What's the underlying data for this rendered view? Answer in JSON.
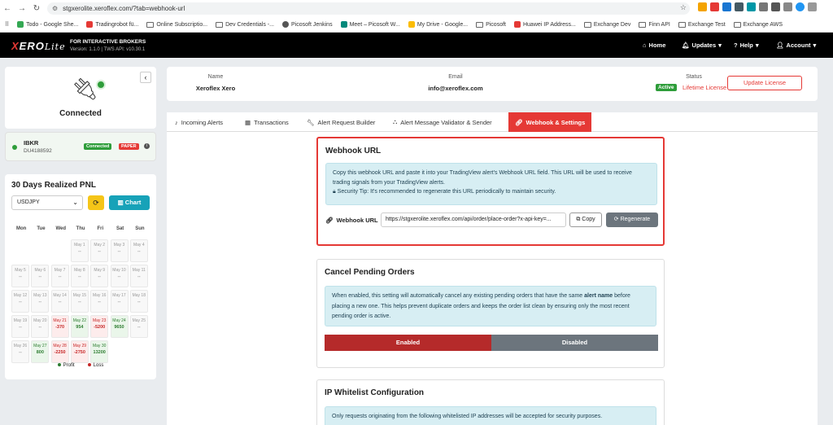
{
  "browser": {
    "url": "stgxerolite.xeroflex.com/?tab=webhook-url",
    "bookmarks": [
      "Todo - Google She...",
      "Tradingrobot fü...",
      "Online Subscriptio...",
      "Dev Credentials -...",
      "Picosoft Jenkins",
      "Meet – Picosoft W...",
      "My Drive - Google...",
      "Picosoft",
      "Huawei IP Address...",
      "Exchange Dev",
      "Finn API",
      "Exchange Test",
      "Exchange AWS"
    ]
  },
  "topnav": {
    "logo_x": "X",
    "logo_rest": "ERO",
    "logo_lite": "Lite",
    "brand_title": "FOR INTERACTIVE BROKERS",
    "brand_version": "Version: 1.1.0 | TWS API: v10.30.1",
    "home": "Home",
    "updates": "Updates",
    "help": "Help",
    "account": "Account"
  },
  "sidebar": {
    "status": "Connected",
    "account_name": "IBKR",
    "account_id": "DU4188592",
    "badge_connected": "Connected",
    "badge_paper": "PAPER",
    "pnl_title": "30 Days Realized PNL",
    "symbol": "USDJPY",
    "chart_label": "Chart",
    "day_names": [
      "Mon",
      "Tue",
      "Wed",
      "Thu",
      "Fri",
      "Sat",
      "Sun"
    ],
    "legend_profit": "Profit",
    "legend_loss": "Loss",
    "colors": {
      "profit": "#2e7d32",
      "loss": "#c62828"
    }
  },
  "calendar": [
    {
      "d": "May 1",
      "v": "--",
      "t": "n",
      "r": 0,
      "c": 3
    },
    {
      "d": "May 2",
      "v": "--",
      "t": "n",
      "r": 0,
      "c": 4
    },
    {
      "d": "May 3",
      "v": "--",
      "t": "n",
      "r": 0,
      "c": 5
    },
    {
      "d": "May 4",
      "v": "--",
      "t": "n",
      "r": 0,
      "c": 6
    },
    {
      "d": "May 5",
      "v": "--",
      "t": "n",
      "r": 1,
      "c": 0
    },
    {
      "d": "May 6",
      "v": "--",
      "t": "n",
      "r": 1,
      "c": 1
    },
    {
      "d": "May 7",
      "v": "--",
      "t": "n",
      "r": 1,
      "c": 2
    },
    {
      "d": "May 8",
      "v": "--",
      "t": "n",
      "r": 1,
      "c": 3
    },
    {
      "d": "May 9",
      "v": "--",
      "t": "n",
      "r": 1,
      "c": 4
    },
    {
      "d": "May 10",
      "v": "--",
      "t": "n",
      "r": 1,
      "c": 5
    },
    {
      "d": "May 11",
      "v": "--",
      "t": "n",
      "r": 1,
      "c": 6
    },
    {
      "d": "May 12",
      "v": "--",
      "t": "n",
      "r": 2,
      "c": 0
    },
    {
      "d": "May 13",
      "v": "--",
      "t": "n",
      "r": 2,
      "c": 1
    },
    {
      "d": "May 14",
      "v": "--",
      "t": "n",
      "r": 2,
      "c": 2
    },
    {
      "d": "May 15",
      "v": "--",
      "t": "n",
      "r": 2,
      "c": 3
    },
    {
      "d": "May 16",
      "v": "--",
      "t": "n",
      "r": 2,
      "c": 4
    },
    {
      "d": "May 17",
      "v": "--",
      "t": "n",
      "r": 2,
      "c": 5
    },
    {
      "d": "May 18",
      "v": "--",
      "t": "n",
      "r": 2,
      "c": 6
    },
    {
      "d": "May 19",
      "v": "--",
      "t": "n",
      "r": 3,
      "c": 0
    },
    {
      "d": "May 20",
      "v": "--",
      "t": "n",
      "r": 3,
      "c": 1
    },
    {
      "d": "May 21",
      "v": "-370",
      "t": "loss",
      "r": 3,
      "c": 2
    },
    {
      "d": "May 22",
      "v": "954",
      "t": "profit",
      "r": 3,
      "c": 3
    },
    {
      "d": "May 23",
      "v": "-5200",
      "t": "loss",
      "r": 3,
      "c": 4
    },
    {
      "d": "May 24",
      "v": "9650",
      "t": "profit",
      "r": 3,
      "c": 5
    },
    {
      "d": "May 25",
      "v": "--",
      "t": "n",
      "r": 3,
      "c": 6
    },
    {
      "d": "May 26",
      "v": "--",
      "t": "n",
      "r": 4,
      "c": 0
    },
    {
      "d": "May 27",
      "v": "800",
      "t": "profit",
      "r": 4,
      "c": 1
    },
    {
      "d": "May 28",
      "v": "-2250",
      "t": "loss",
      "r": 4,
      "c": 2
    },
    {
      "d": "May 29",
      "v": "-2750",
      "t": "loss",
      "r": 4,
      "c": 3
    },
    {
      "d": "May 30",
      "v": "13200",
      "t": "profit",
      "r": 4,
      "c": 4
    }
  ],
  "license": {
    "name_label": "Name",
    "name": "Xeroflex Xero",
    "email_label": "Email",
    "email": "info@xeroflex.com",
    "status_label": "Status",
    "status_active": "Active",
    "status_type": "Lifetime License",
    "update_btn": "Update License"
  },
  "tabs": [
    {
      "label": "Incoming Alerts",
      "icon": "bell-icon"
    },
    {
      "label": "Transactions",
      "icon": "table-icon"
    },
    {
      "label": "Alert Request Builder",
      "icon": "wrench-icon"
    },
    {
      "label": "Alert Message Validator & Sender",
      "icon": "sitemap-icon"
    },
    {
      "label": "Webhook & Settings",
      "icon": "link-icon"
    }
  ],
  "webhook": {
    "title": "Webhook URL",
    "info": "Copy this webhook URL and paste it into your TradingView alert's Webhook URL field. This URL will be used to receive trading signals from your TradingView alerts.",
    "tip": "Security Tip: It's recommended to regenerate this URL periodically to maintain security.",
    "field_label": "Webhook URL",
    "url": "https://stgxerolite.xeroflex.com/api/order/place-order?x-api-key=...",
    "copy": "Copy",
    "regenerate": "Regenerate"
  },
  "cancel_pending": {
    "title": "Cancel Pending Orders",
    "info_a": "When enabled, this setting will automatically cancel any existing pending orders that have the same ",
    "info_b": "alert name",
    "info_c": " before placing a new one. This helps prevent duplicate orders and keeps the order list clean by ensuring only the most recent pending order is active.",
    "enabled": "Enabled",
    "disabled": "Disabled"
  },
  "whitelist": {
    "title": "IP Whitelist Configuration",
    "info": "Only requests originating from the following whitelisted IP addresses will be accepted for security purposes."
  }
}
